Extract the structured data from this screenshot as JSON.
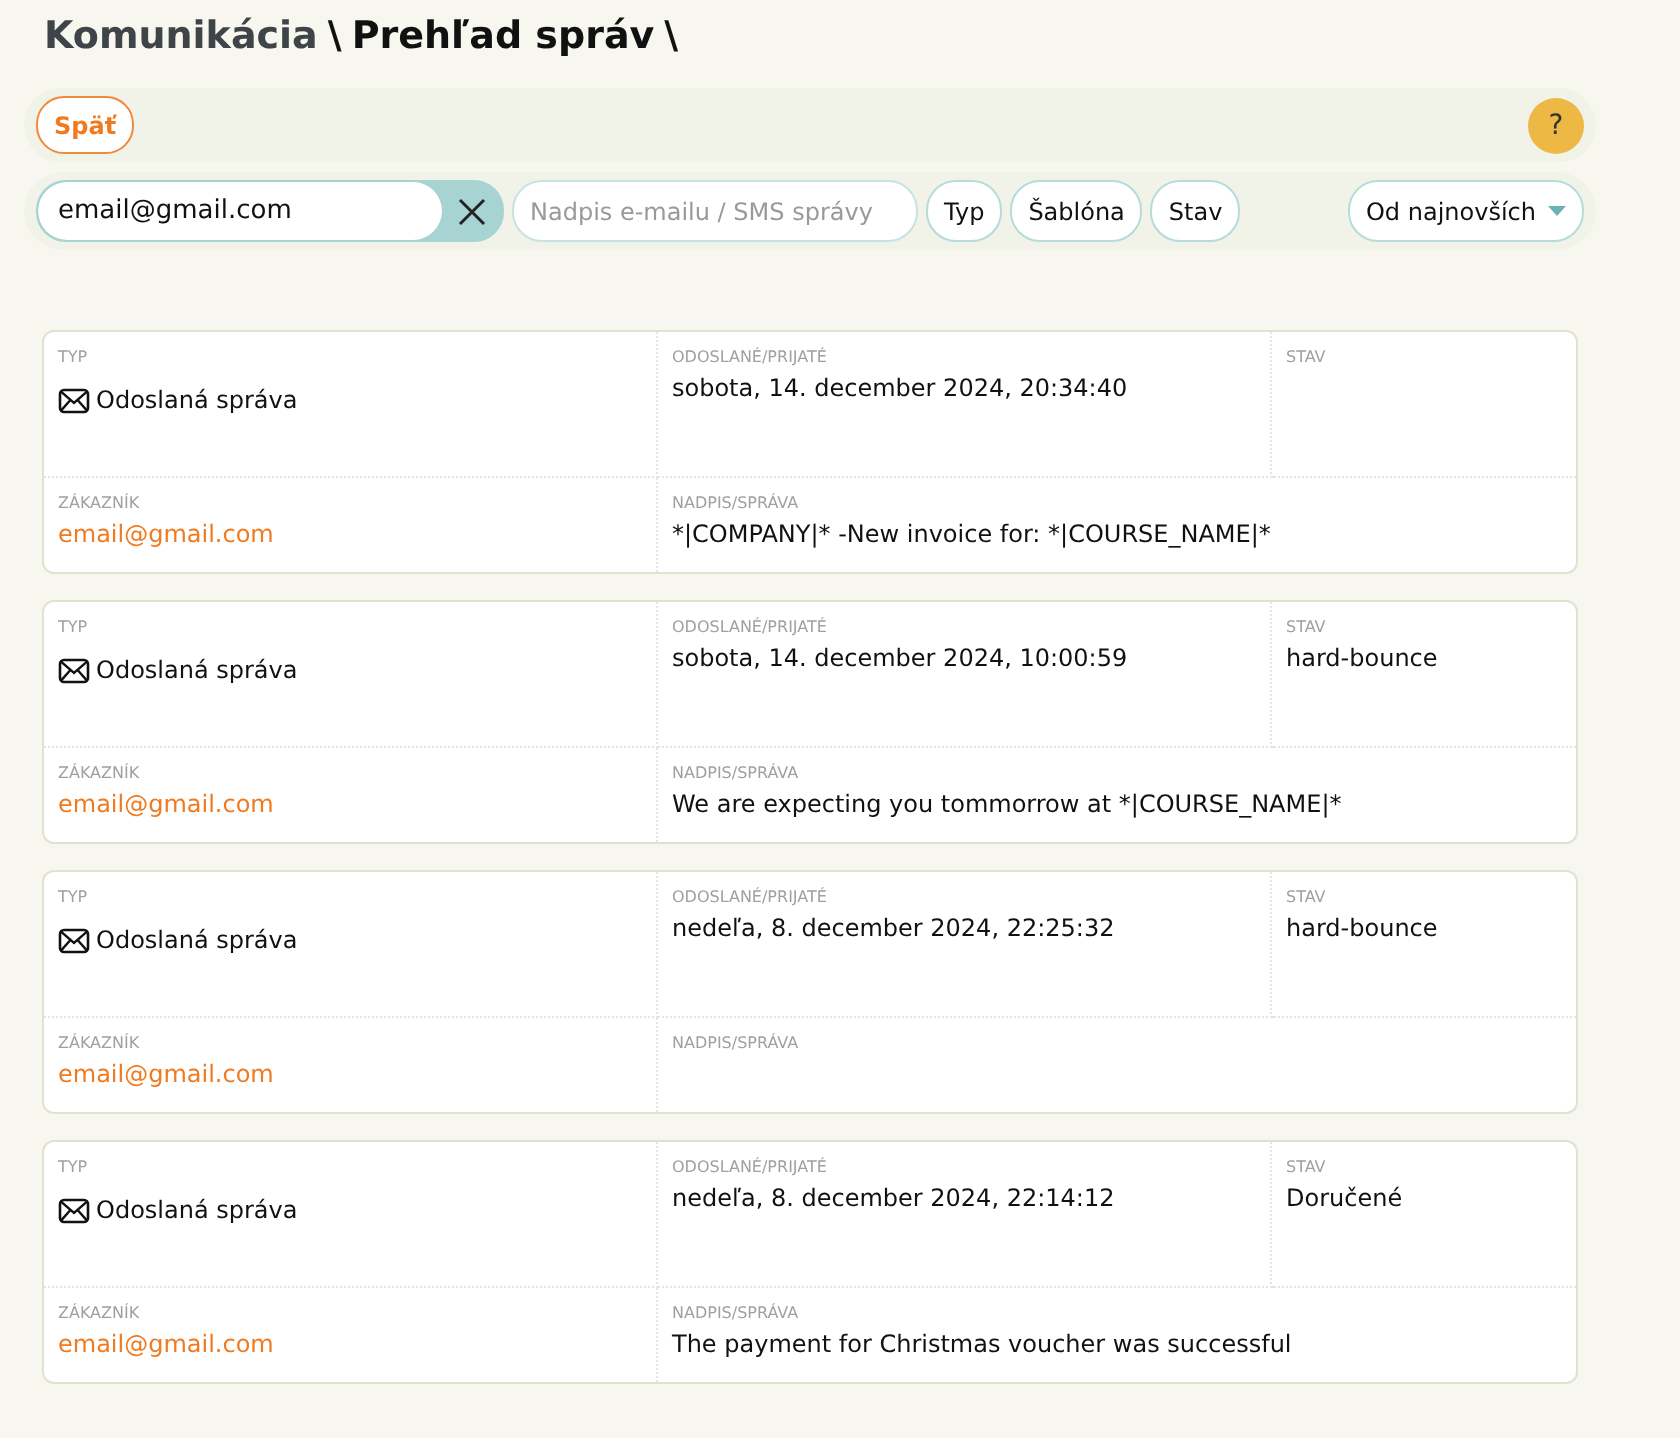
{
  "breadcrumb": {
    "section": "Komunikácia",
    "separator_1": "\\",
    "page": "Prehľad správ",
    "separator_2": "\\"
  },
  "toolbar": {
    "back_button": "Späť",
    "help_button": "?"
  },
  "filters": {
    "email": {
      "value": "email@gmail.com"
    },
    "subject": {
      "placeholder": "Nadpis e-mailu / SMS správy"
    },
    "buttons": [
      "Typ",
      "Šablóna",
      "Stav"
    ],
    "sort": {
      "value": "Od najnovších"
    }
  },
  "messages": [
    {
      "labels": {
        "type": "TYP",
        "sent": "ODOSLANÉ/PRIJATÉ",
        "status": "STAV",
        "customer": "ZÁKAZNÍK",
        "subject": "NADPIS/SPRÁVA"
      },
      "type": "Odoslaná správa",
      "sent": "sobota, 14. december 2024, 20:34:40",
      "customer": "email@gmail.com",
      "subject": "*|COMPANY|* -New invoice for: *|COURSE_NAME|*"
    },
    {
      "labels": {
        "type": "TYP",
        "sent": "ODOSLANÉ/PRIJATÉ",
        "status": "STAV",
        "customer": "ZÁKAZNÍK",
        "subject": "NADPIS/SPRÁVA"
      },
      "type": "Odoslaná správa",
      "sent": "sobota, 14. december 2024, 10:00:59",
      "status": "hard-bounce",
      "customer": "email@gmail.com",
      "subject": "We are expecting you tommorrow at *|COURSE_NAME|*"
    },
    {
      "labels": {
        "type": "TYP",
        "sent": "ODOSLANÉ/PRIJATÉ",
        "status": "STAV",
        "customer": "ZÁKAZNÍK",
        "subject": "NADPIS/SPRÁVA"
      },
      "type": "Odoslaná správa",
      "sent": "nedeľa, 8. december 2024, 22:25:32",
      "status": "hard-bounce",
      "customer": "email@gmail.com"
    },
    {
      "labels": {
        "type": "TYP",
        "sent": "ODOSLANÉ/PRIJATÉ",
        "status": "STAV",
        "customer": "ZÁKAZNÍK",
        "subject": "NADPIS/SPRÁVA"
      },
      "type": "Odoslaná správa",
      "sent": "nedeľa, 8. december 2024, 22:14:12",
      "status": "Doručené",
      "customer": "email@gmail.com",
      "subject": "The payment for Christmas voucher was successful"
    }
  ]
}
